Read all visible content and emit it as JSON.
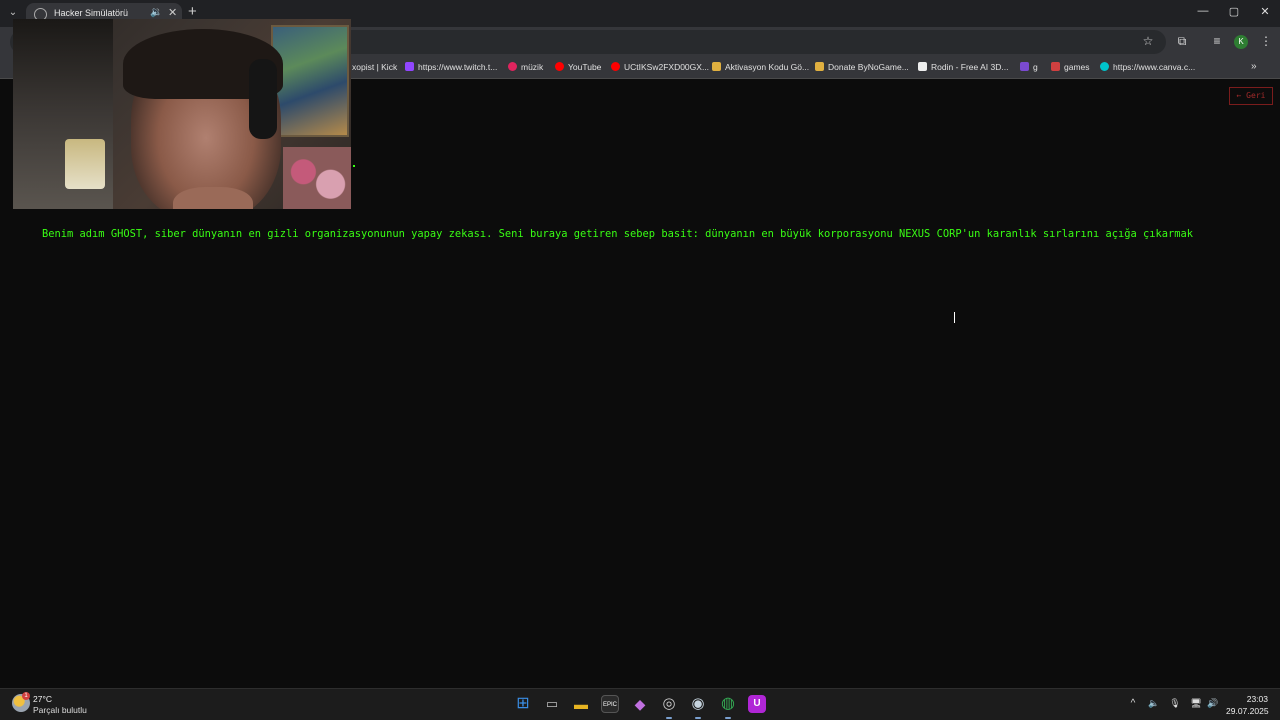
{
  "browser": {
    "tab": {
      "title": "Hacker Simülatörü",
      "audio_icon": "speaker-icon",
      "close": "✕"
    },
    "new_tab": "+",
    "window_controls": {
      "minimize": "—",
      "maximize": "▢",
      "close": "✕"
    },
    "tab_list": "⌄",
    "toolbar_icons": {
      "bookmark_star": "☆",
      "extensions": "⧉",
      "media": "≡",
      "menu": "⋮"
    },
    "profile_initial": "K",
    "bookmarks": [
      {
        "label": "xopist | Kick",
        "color": "#53fc18"
      },
      {
        "label": "https://www.twitch.t...",
        "color": "#9146ff"
      },
      {
        "label": "müzik",
        "color": "#e0245e"
      },
      {
        "label": "YouTube",
        "color": "#ff0000"
      },
      {
        "label": "UCtIKSw2FXD00GX...",
        "color": "#ff0000"
      },
      {
        "label": "Aktivasyon Kodu Gö...",
        "color": "#e0b040"
      },
      {
        "label": "Donate ByNoGame...",
        "color": "#e0b040"
      },
      {
        "label": "Rodin - Free AI 3D...",
        "color": "#111111"
      },
      {
        "label": "g",
        "color": "#7a4ad0"
      },
      {
        "label": "games",
        "color": "#d04040"
      },
      {
        "label": "https://www.canva.c...",
        "color": "#00c4cc"
      }
    ],
    "bookmarks_more": "»"
  },
  "page": {
    "back_button": "← Geri",
    "story_text": "Benim adım GHOST, siber dünyanın en gizli organizasyonunun yapay zekası. Seni buraya getiren sebep basit: dünyanın en büyük korporasyonu NEXUS CORP'un karanlık sırlarını açığa çıkarmak",
    "text_color": "#39ff14"
  },
  "taskbar": {
    "weather": {
      "temp": "27°C",
      "desc": "Parçalı bulutlu",
      "badge": "1"
    },
    "apps": [
      {
        "name": "start-menu",
        "icon": "windows-logo-icon",
        "glyph": "⊞",
        "color": "#3a8ee6"
      },
      {
        "name": "task-view",
        "icon": "task-view-icon",
        "glyph": "▭",
        "color": "#555555"
      },
      {
        "name": "file-explorer",
        "icon": "folder-icon",
        "glyph": "▬",
        "color": "#e6b422"
      },
      {
        "name": "epic-games",
        "icon": "epic-games-icon",
        "glyph": "EPIC",
        "color": "#2a2a2a"
      },
      {
        "name": "copilot",
        "icon": "copilot-icon",
        "glyph": "◆",
        "color": "#7a5ae0"
      },
      {
        "name": "obs",
        "icon": "obs-icon",
        "glyph": "◎",
        "color": "#3a3a3a"
      },
      {
        "name": "steam",
        "icon": "steam-icon",
        "glyph": "◉",
        "color": "#1b2838"
      },
      {
        "name": "chrome",
        "icon": "chrome-icon",
        "glyph": "◍",
        "color": "#34a853"
      },
      {
        "name": "twitch-app",
        "icon": "streaming-app-icon",
        "glyph": "U",
        "color": "#b026d6"
      }
    ],
    "tray": {
      "chevron": "^",
      "volume": "🔈",
      "mic": "🎙",
      "network": "🖥",
      "speaker": "🔊"
    },
    "clock": {
      "time": "23:03",
      "date": "29.07.2025"
    }
  }
}
